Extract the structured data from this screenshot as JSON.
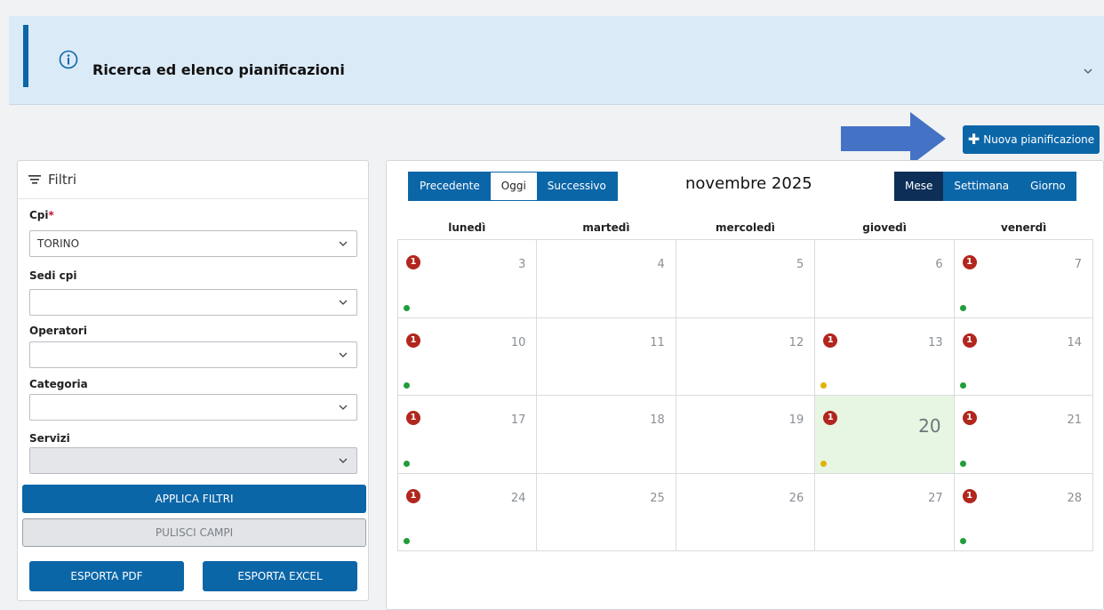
{
  "banner": {
    "title": "Ricerca ed elenco pianificazioni"
  },
  "actions": {
    "new_label": "Nuova pianificazione"
  },
  "filters": {
    "header": "Filtri",
    "cpi_label": "Cpi",
    "cpi_required": "*",
    "cpi_value": "TORINO",
    "sedi_label": "Sedi cpi",
    "sedi_value": "",
    "operatori_label": "Operatori",
    "operatori_value": "",
    "categoria_label": "Categoria",
    "categoria_value": "",
    "servizi_label": "Servizi",
    "servizi_value": "",
    "apply_label": "APPLICA FILTRI",
    "clear_label": "PULISCI CAMPI",
    "export_pdf_label": "ESPORTA PDF",
    "export_excel_label": "ESPORTA EXCEL"
  },
  "calendar": {
    "prev_label": "Precedente",
    "today_label": "Oggi",
    "next_label": "Successivo",
    "month_title": "novembre 2025",
    "view_month": "Mese",
    "view_week": "Settimana",
    "view_day": "Giorno",
    "active_view": "Mese",
    "weekdays": [
      "lunedì",
      "martedì",
      "mercoledì",
      "giovedì",
      "venerdì"
    ],
    "weeks": [
      [
        {
          "day": "3",
          "badge": "1",
          "dot": "green"
        },
        {
          "day": "4"
        },
        {
          "day": "5"
        },
        {
          "day": "6"
        },
        {
          "day": "7",
          "badge": "1",
          "dot": "green"
        }
      ],
      [
        {
          "day": "10",
          "badge": "1",
          "dot": "green"
        },
        {
          "day": "11"
        },
        {
          "day": "12"
        },
        {
          "day": "13",
          "badge": "1",
          "dot": "yellow"
        },
        {
          "day": "14",
          "badge": "1",
          "dot": "green"
        }
      ],
      [
        {
          "day": "17",
          "badge": "1",
          "dot": "green"
        },
        {
          "day": "18"
        },
        {
          "day": "19"
        },
        {
          "day": "20",
          "badge": "1",
          "dot": "yellow",
          "today": true
        },
        {
          "day": "21",
          "badge": "1",
          "dot": "green"
        }
      ],
      [
        {
          "day": "24",
          "badge": "1",
          "dot": "green"
        },
        {
          "day": "25"
        },
        {
          "day": "26"
        },
        {
          "day": "27"
        },
        {
          "day": "28",
          "badge": "1",
          "dot": "green"
        }
      ]
    ]
  },
  "colors": {
    "primary": "#0b66a8",
    "active_view": "#0d2e57",
    "badge": "#b1261d",
    "dot_green": "#1f9d3a",
    "dot_yellow": "#e0b300",
    "today_bg": "#e6f6e3",
    "banner_bg": "#dbeaf7"
  }
}
